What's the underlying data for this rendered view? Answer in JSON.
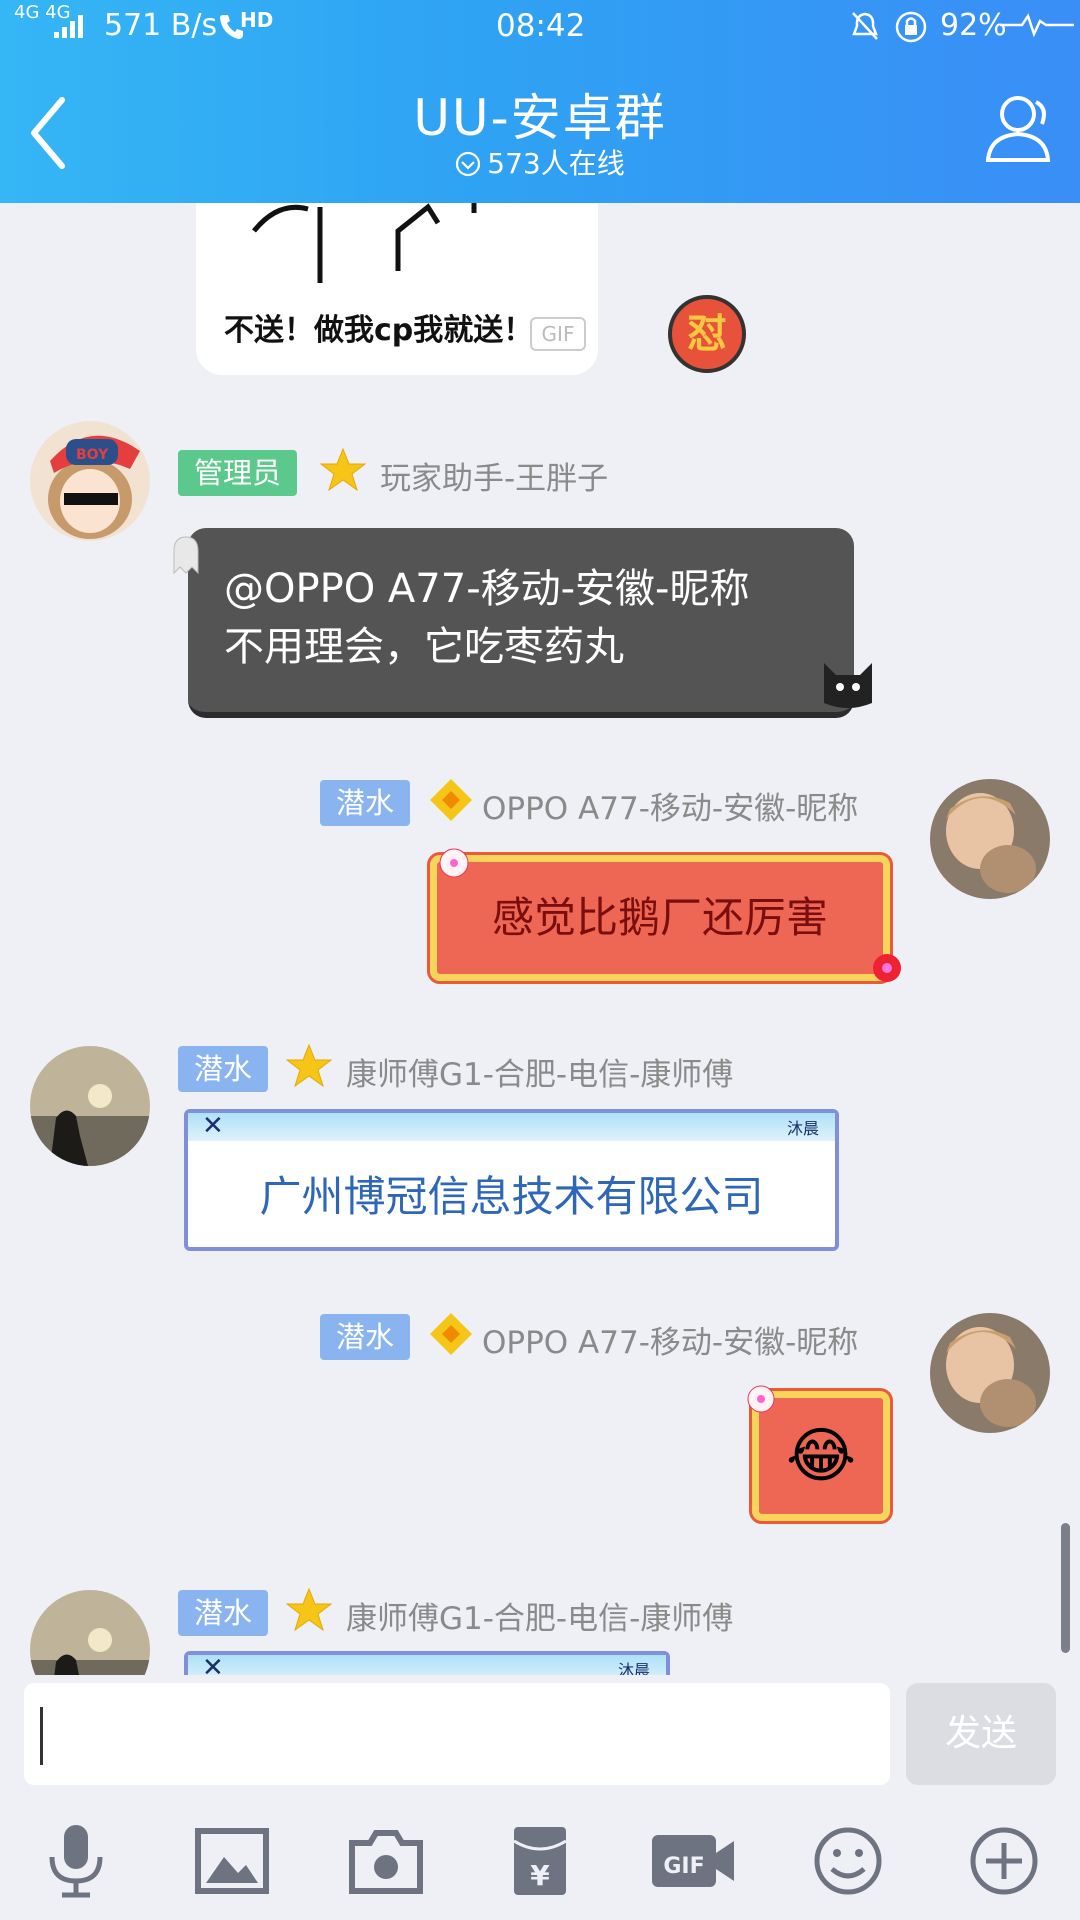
{
  "status_bar": {
    "network": "4G 4G",
    "speed": "571 B/s",
    "hd": "HD",
    "time": "08:42",
    "battery": "92%"
  },
  "header": {
    "title": "UU-安卓群",
    "online": "573人在线"
  },
  "messages": [
    {
      "sticker_caption": "不送！做我cp我就送！",
      "gif_label": "GIF",
      "reaction": "怼"
    },
    {
      "badge": "管理员",
      "nickname": "玩家助手-王胖子",
      "text_line1": "@OPPO A77-移动-安徽-昵称",
      "text_line2": "不用理会，它吃枣药丸"
    },
    {
      "badge": "潜水",
      "nickname": "OPPO A77-移动-安徽-昵称",
      "text": "感觉比鹅厂还厉害"
    },
    {
      "badge": "潜水",
      "nickname": "康师傅G1-合肥-电信-康师傅",
      "card_mark": "沐晨",
      "text": "广州博冠信息技术有限公司"
    },
    {
      "badge": "潜水",
      "nickname": "OPPO A77-移动-安徽-昵称",
      "emoji": "😂"
    },
    {
      "badge": "潜水",
      "nickname": "康师傅G1-合肥-电信-康师傅",
      "card_mark": "沐晨"
    }
  ],
  "input": {
    "value": "",
    "send_label": "发送"
  },
  "toolbar_icons": [
    "microphone-icon",
    "image-icon",
    "camera-icon",
    "red-packet-icon",
    "gif-icon",
    "emoji-icon",
    "plus-icon"
  ],
  "colors": {
    "header": "#2fa2f3",
    "admin_tag": "#5cc98c",
    "diver_tag": "#8ab4f0",
    "background": "#eef0f6"
  }
}
